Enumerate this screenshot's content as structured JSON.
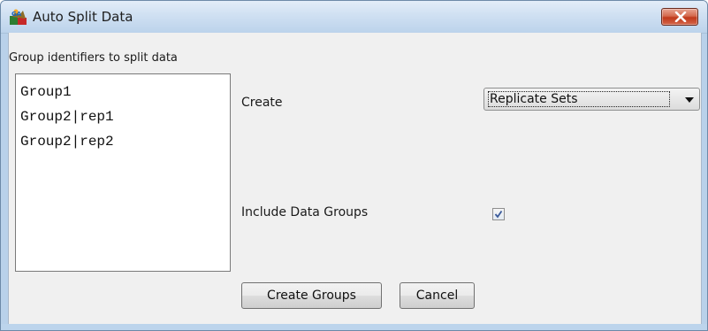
{
  "window": {
    "title": "Auto Split Data"
  },
  "group_panel": {
    "label": "Group identifiers to split data",
    "items": [
      "Group1",
      "Group2|rep1",
      "Group2|rep2"
    ]
  },
  "create": {
    "label": "Create",
    "selected": "Replicate Sets"
  },
  "include": {
    "label": "Include Data Groups",
    "checked": true
  },
  "buttons": {
    "create_groups": "Create Groups",
    "cancel": "Cancel"
  },
  "colors": {
    "close_button": "#c0391a",
    "title_bar": "#cfe0f2",
    "dialog_background": "#f0f0f0"
  }
}
